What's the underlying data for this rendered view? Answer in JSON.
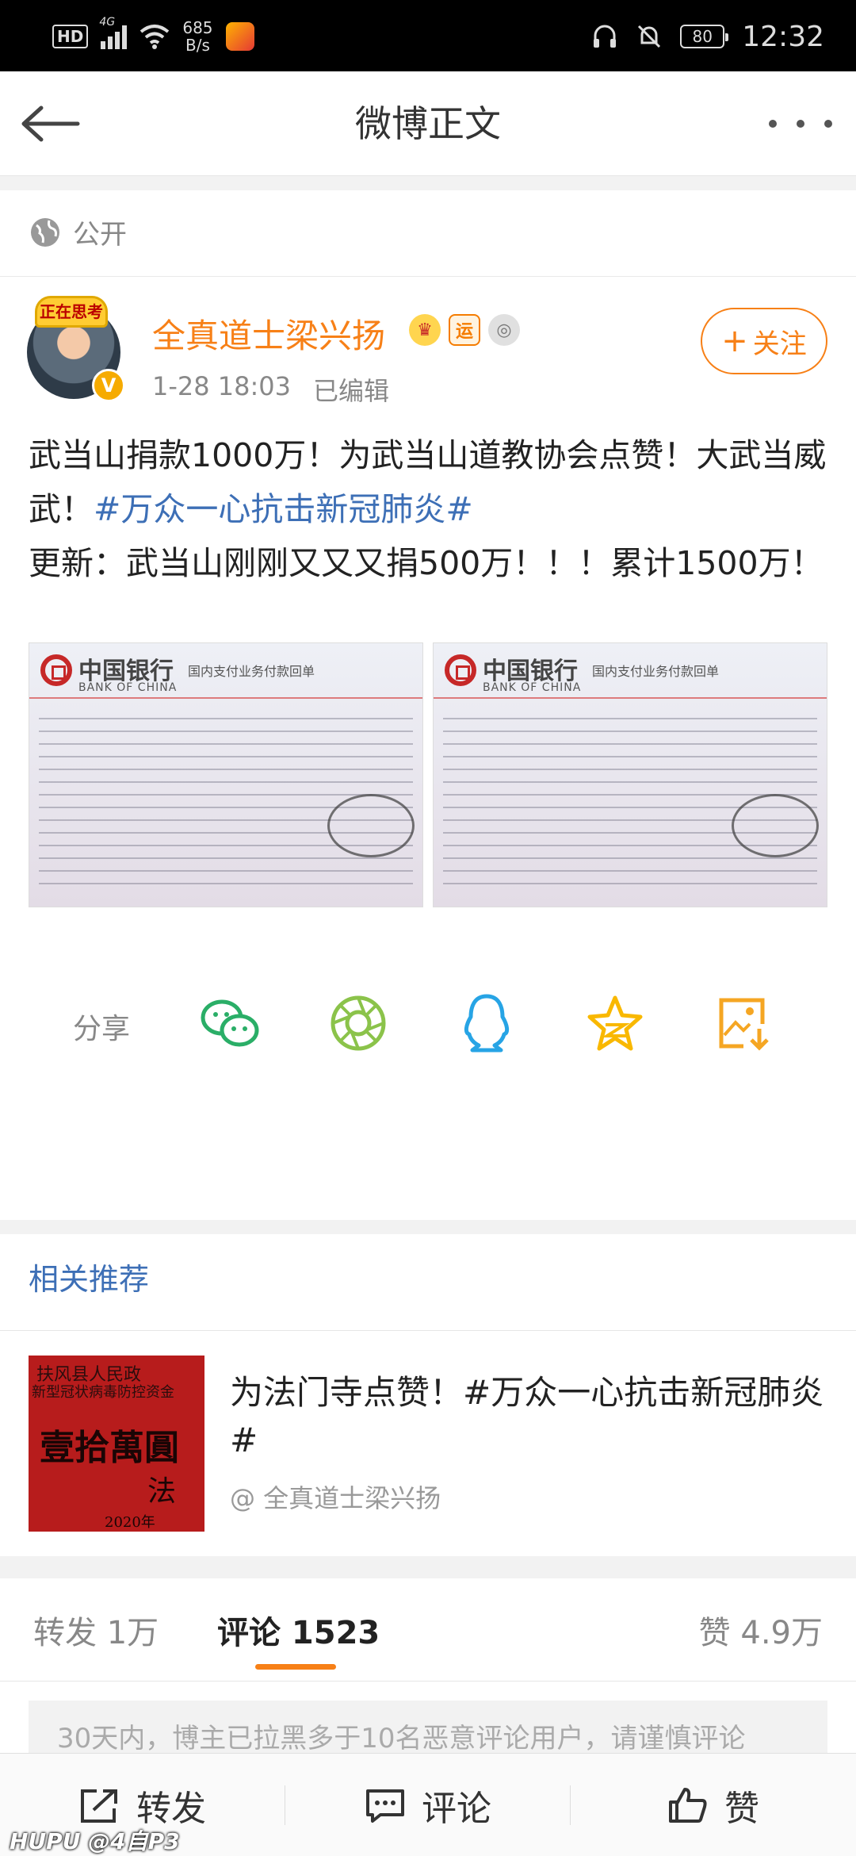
{
  "status_bar": {
    "hd": "HD",
    "network": "4G",
    "speed_value": "685",
    "speed_unit": "B/s",
    "battery": "80",
    "time": "12:32"
  },
  "nav": {
    "title": "微博正文"
  },
  "post": {
    "visibility": "公开",
    "avatar_tag": "正在思考",
    "verified_mark": "V",
    "author": "全真道士梁兴扬",
    "badge_yun": "运",
    "timestamp": "1-28 18:03",
    "edited": "已编辑",
    "follow_label": "关注",
    "text_line1": "武当山捐款1000万！为武当山道教协会点赞！大武当威武！",
    "topic": "#万众一心抗击新冠肺炎#",
    "text_line2": "更新：武当山刚刚又又又捐500万！！！累计1500万！",
    "images": [
      {
        "bank_cn": "中国银行",
        "bank_en": "BANK OF CHINA",
        "doc_title": "国内支付业务付款回单"
      },
      {
        "bank_cn": "中国银行",
        "bank_en": "BANK OF CHINA",
        "doc_title": "国内支付业务付款回单"
      }
    ]
  },
  "share": {
    "label": "分享",
    "icons": [
      "wechat-icon",
      "moments-icon",
      "qq-icon",
      "qzone-icon",
      "save-image-icon"
    ]
  },
  "related": {
    "title": "相关推荐",
    "thumb_lines": [
      "扶风县人民政",
      "新型冠状病毒防控资金",
      "壹拾萬圓",
      "法",
      "2020年"
    ],
    "post_title": "为法门寺点赞！#万众一心抗击新冠肺炎#",
    "author": "@ 全真道士梁兴扬"
  },
  "tabs": {
    "repost": "转发 1万",
    "comment": "评论 1523",
    "like": "赞 4.9万"
  },
  "comment_notice": "30天内，博主已拉黑多于10名恶意评论用户，请谨慎评论",
  "bottom_bar": {
    "repost": "转发",
    "comment": "评论",
    "like": "赞"
  },
  "watermark": "HUPU @4自P3",
  "colors": {
    "accent": "#f78017",
    "link": "#3d6fb6"
  }
}
